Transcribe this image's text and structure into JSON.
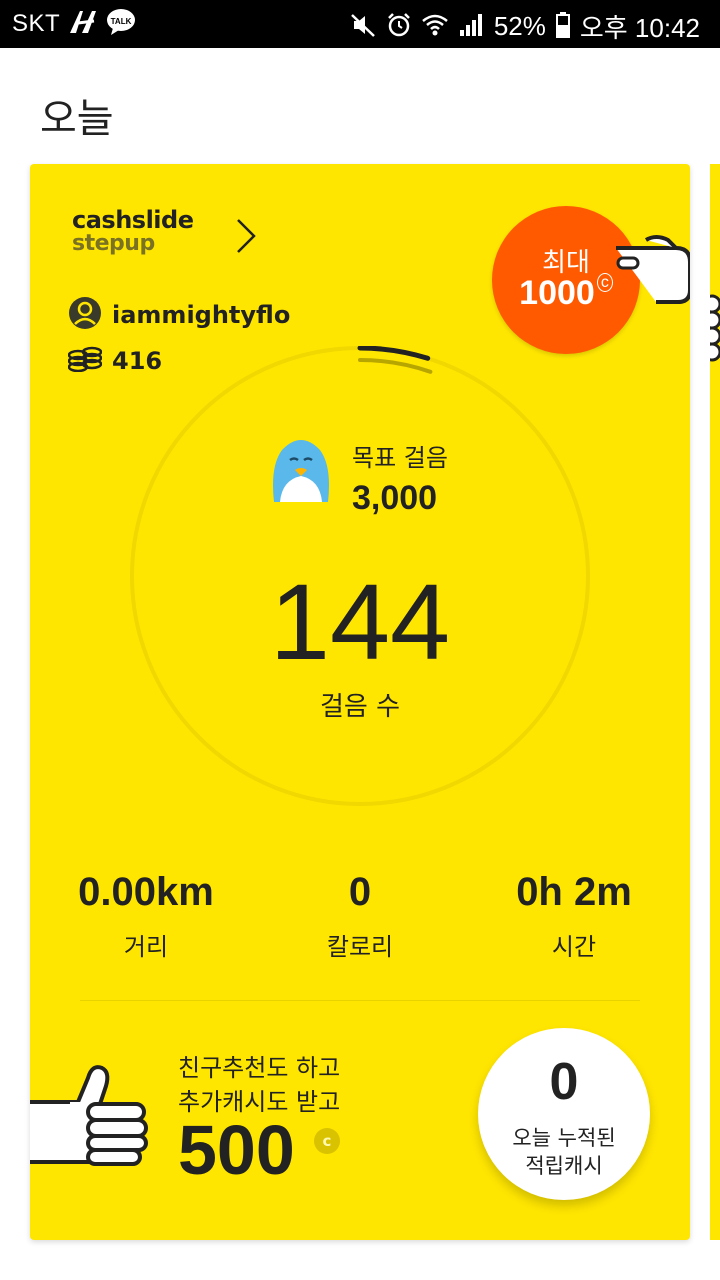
{
  "status_bar": {
    "carrier": "SKT",
    "talk_badge": "TALK",
    "battery": "52%",
    "time": "오후 10:42",
    "icons": [
      "lte-icon",
      "talk-icon",
      "mute-icon",
      "alarm-icon",
      "wifi-icon",
      "signal-icon",
      "battery-icon"
    ]
  },
  "header": {
    "title": "오늘"
  },
  "card": {
    "brand": {
      "line1": "cashslide",
      "line2": "stepup"
    },
    "user": {
      "name": "iammightyflo"
    },
    "coins": {
      "count": "416"
    },
    "max_badge": {
      "label": "최대",
      "value": "1000"
    },
    "goal": {
      "label": "목표 걸음",
      "value": "3,000"
    },
    "steps": {
      "value": "144",
      "label": "걸음 수",
      "progress_fraction": 0.048
    },
    "stats": [
      {
        "value": "0.00km",
        "label": "거리"
      },
      {
        "value": "0",
        "label": "칼로리"
      },
      {
        "value": "0h 2m",
        "label": "시간"
      }
    ],
    "promo": {
      "line1": "친구추천도 하고",
      "line2": "추가캐시도 받고",
      "amount": "500"
    },
    "cash": {
      "value": "0",
      "label_line1": "오늘 누적된",
      "label_line2": "적립캐시"
    }
  },
  "colors": {
    "card_bg": "#ffe600",
    "accent_orange": "#ff5a00",
    "text": "#222222"
  }
}
